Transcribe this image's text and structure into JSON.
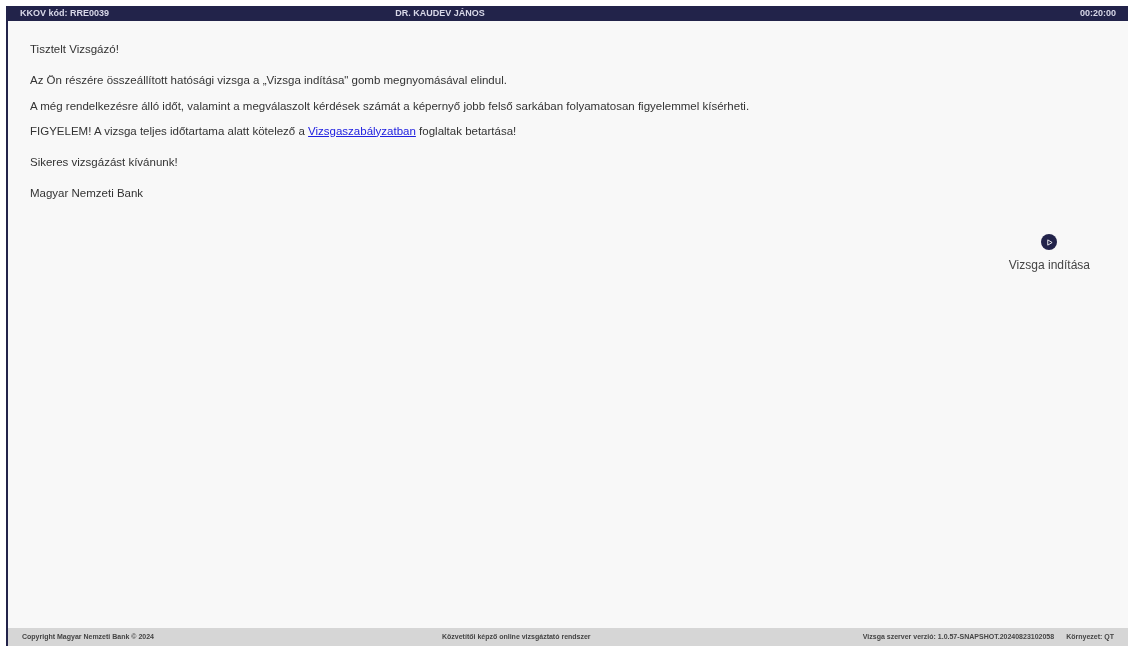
{
  "header": {
    "code": "KKOV kód: RRE0039",
    "name": "DR. KAUDEV JÁNOS",
    "timer": "00:20:00"
  },
  "greeting": "Tisztelt Vizsgázó!",
  "paragraphs": [
    "Az Ön részére összeállított hatósági vizsga a „Vizsga indítása\" gomb megnyomásával elindul.",
    "A még rendelkezésre álló időt, valamint a megválaszolt kérdések számát a képernyő jobb felső sarkában folyamatosan figyelemmel kísérheti."
  ],
  "warning": {
    "before": "FIGYELEM! A vizsga teljes időtartama alatt kötelező a ",
    "link": "Vizsgaszabályzatban",
    "after": " foglaltak betartása!"
  },
  "wish": "Sikeres vizsgázást kívánunk!",
  "signature": "Magyar Nemzeti Bank",
  "start_button": {
    "label": "Vizsga indítása"
  },
  "footer": {
    "copyright": "Copyright Magyar Nemzeti Bank © 2024",
    "system": "Közvetítői képző online vizsgáztató rendszer",
    "version": "Vizsga szerver verzió: 1.0.57-SNAPSHOT.20240823102058",
    "environment": "Környezet: QT"
  }
}
